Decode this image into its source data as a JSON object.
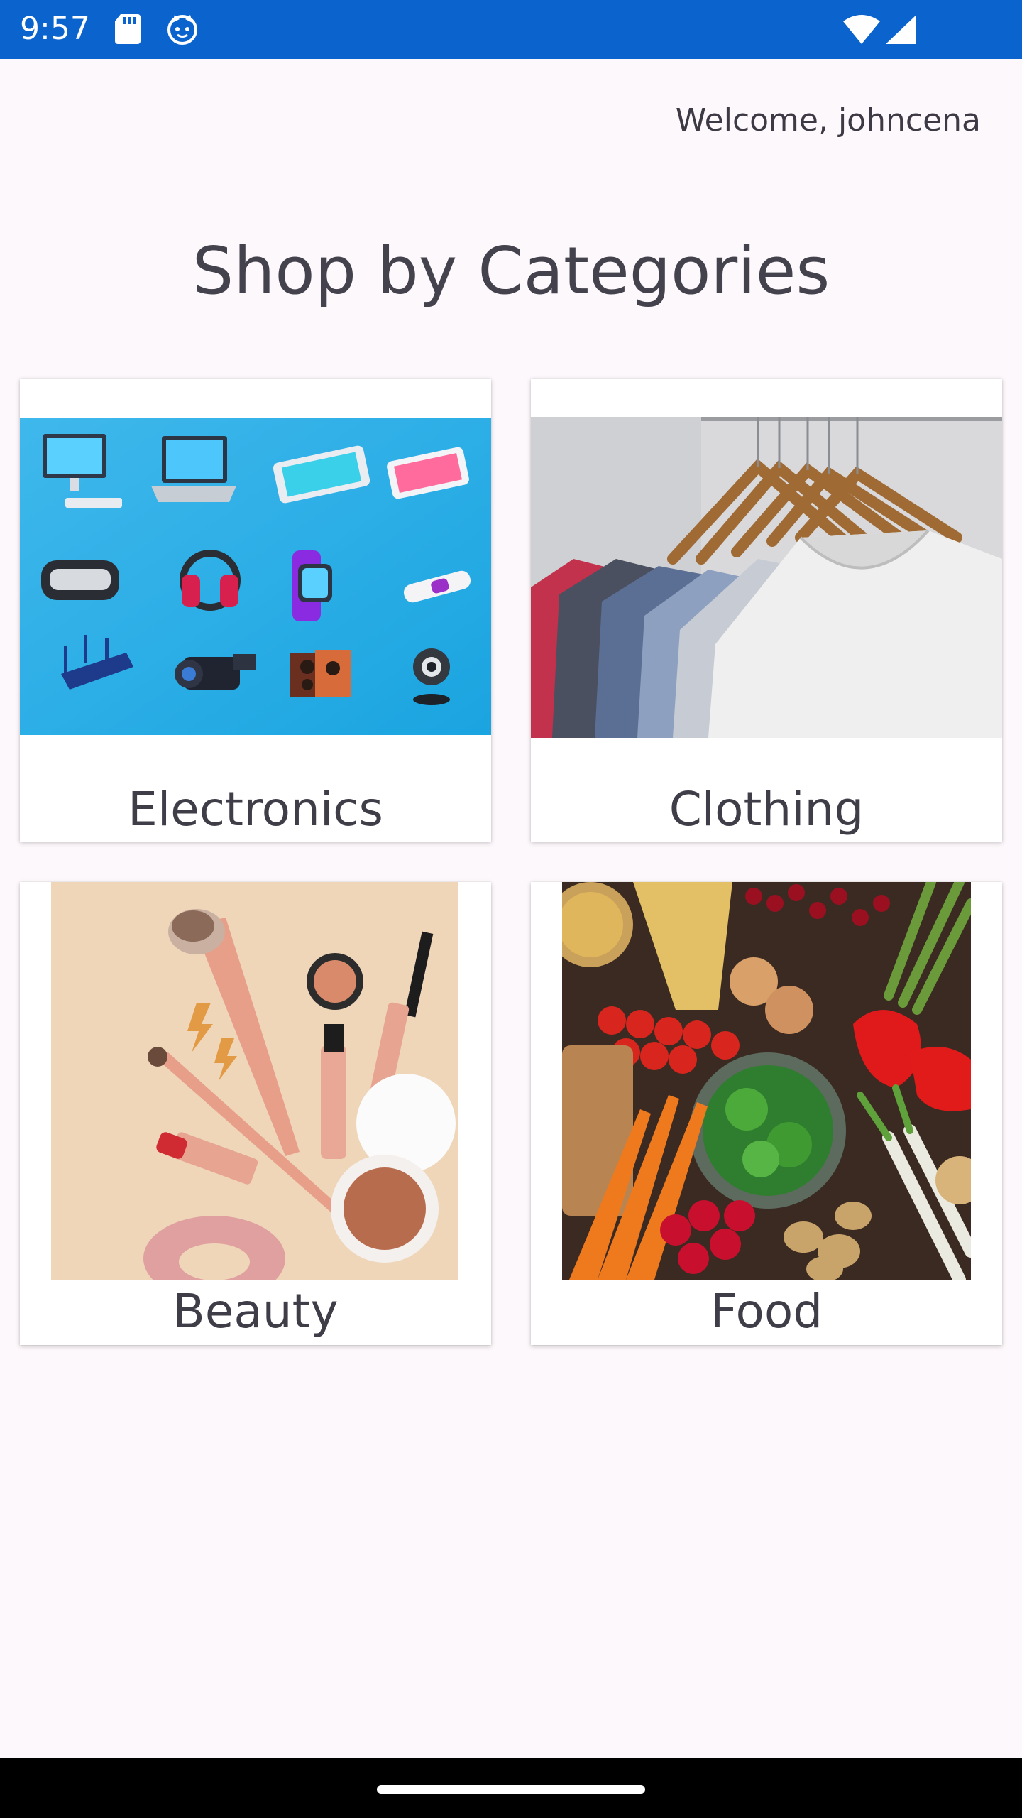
{
  "status_bar": {
    "time": "9:57",
    "icons": [
      "sd-card-icon",
      "cat-face-icon",
      "wifi-icon",
      "cell-signal-icon"
    ],
    "background": "#0b64cd"
  },
  "header": {
    "welcome_text": "Welcome, johncena"
  },
  "main": {
    "title": "Shop by Categories",
    "categories": [
      {
        "label": "Electronics",
        "image": "electronics-image"
      },
      {
        "label": "Clothing",
        "image": "clothing-image"
      },
      {
        "label": "Beauty",
        "image": "beauty-image"
      },
      {
        "label": "Food",
        "image": "food-image"
      }
    ]
  },
  "colors": {
    "page_background": "#fdf8fb",
    "text": "#3f3d47",
    "card_background": "#ffffff"
  }
}
